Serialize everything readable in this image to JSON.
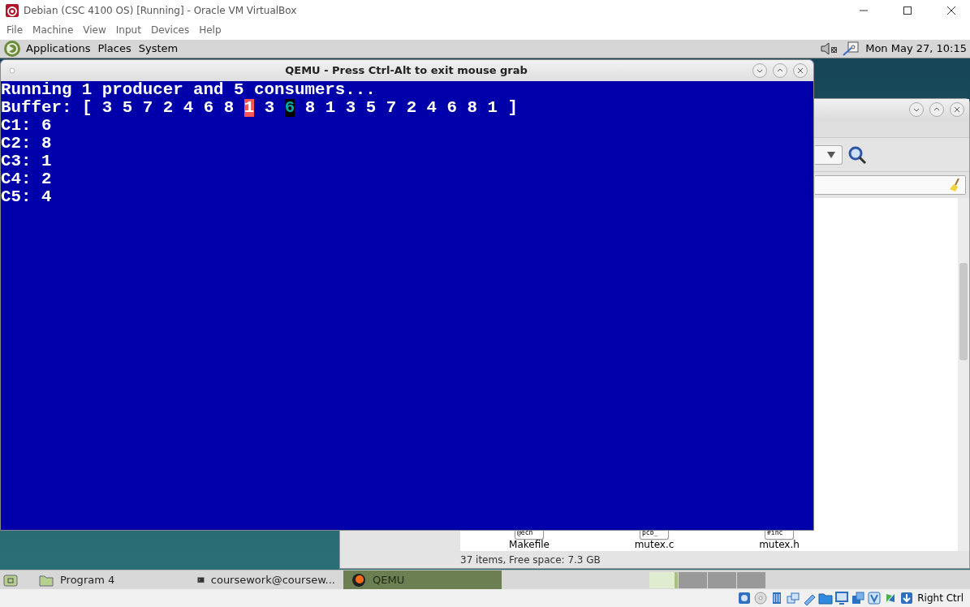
{
  "host_window": {
    "title": "Debian (CSC 4100 OS) [Running] - Oracle VM VirtualBox"
  },
  "host_menu": [
    "File",
    "Machine",
    "View",
    "Input",
    "Devices",
    "Help"
  ],
  "guest_panel": {
    "menus": [
      "Applications",
      "Places",
      "System"
    ],
    "clock": "Mon May 27, 10:15"
  },
  "file_manager": {
    "files": [
      {
        "name": "Makefile",
        "preview": "@ech"
      },
      {
        "name": "mutex.c",
        "preview": "pcb_"
      },
      {
        "name": "mutex.h",
        "preview": "#inc"
      }
    ],
    "status": "37 items, Free space: 7.3 GB"
  },
  "qemu_window": {
    "title": "QEMU - Press Ctrl-Alt to exit mouse grab",
    "console": {
      "header": "Running 1 producer and 5 consumers...",
      "buffer": {
        "label": "Buffer:",
        "open": "[",
        "close": "]",
        "items": [
          {
            "value": "3",
            "kind": "plain"
          },
          {
            "value": "5",
            "kind": "plain"
          },
          {
            "value": "7",
            "kind": "plain"
          },
          {
            "value": "2",
            "kind": "plain"
          },
          {
            "value": "4",
            "kind": "plain"
          },
          {
            "value": "6",
            "kind": "plain"
          },
          {
            "value": "8",
            "kind": "plain"
          },
          {
            "value": "1",
            "kind": "producer"
          },
          {
            "value": "3",
            "kind": "plain"
          },
          {
            "value": "6",
            "kind": "consumer"
          },
          {
            "value": "8",
            "kind": "plain"
          },
          {
            "value": "1",
            "kind": "plain"
          },
          {
            "value": "3",
            "kind": "plain"
          },
          {
            "value": "5",
            "kind": "plain"
          },
          {
            "value": "7",
            "kind": "plain"
          },
          {
            "value": "2",
            "kind": "plain"
          },
          {
            "value": "4",
            "kind": "plain"
          },
          {
            "value": "6",
            "kind": "plain"
          },
          {
            "value": "8",
            "kind": "plain"
          },
          {
            "value": "1",
            "kind": "plain"
          }
        ]
      },
      "consumers": [
        {
          "label": "C1:",
          "value": "6"
        },
        {
          "label": "C2:",
          "value": "8"
        },
        {
          "label": "C3:",
          "value": "1"
        },
        {
          "label": "C4:",
          "value": "2"
        },
        {
          "label": "C5:",
          "value": "4"
        }
      ]
    }
  },
  "taskbar": {
    "tasks": [
      {
        "label": "Program 4",
        "kind": "folder",
        "selected": false
      },
      {
        "label": "coursework@coursew...",
        "kind": "terminal",
        "selected": false
      },
      {
        "label": "QEMU",
        "kind": "qemu",
        "selected": true
      }
    ],
    "workspaces": [
      {
        "selected": true
      },
      {
        "selected": false
      },
      {
        "selected": false
      },
      {
        "selected": false
      }
    ]
  },
  "host_status": {
    "host_key": "Right Ctrl"
  }
}
